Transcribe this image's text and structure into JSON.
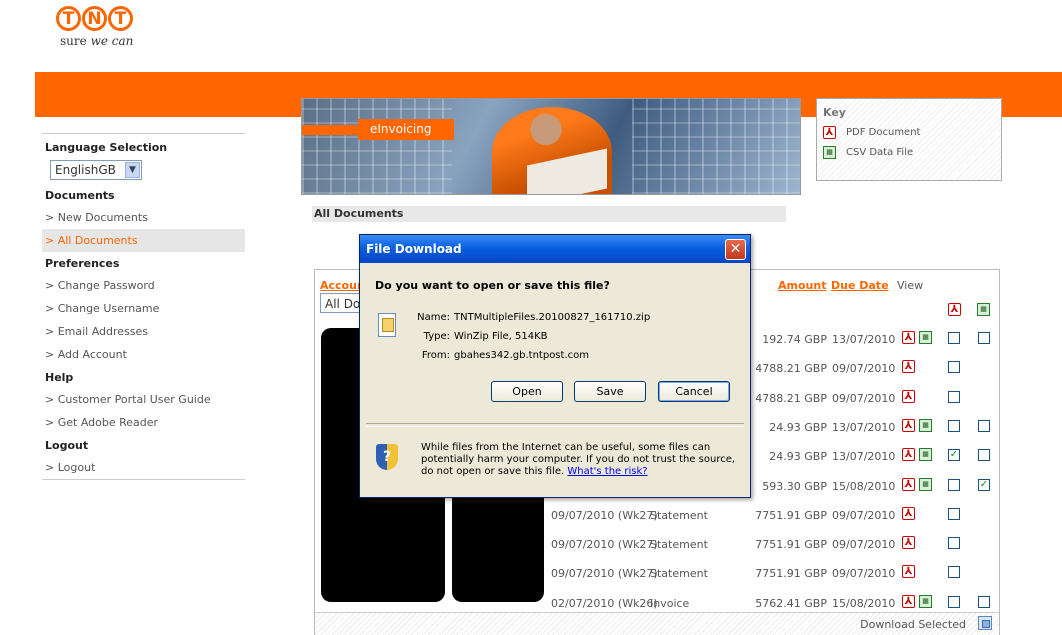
{
  "brand": {
    "letters": [
      "T",
      "N",
      "T"
    ],
    "tagline_prefix": "sure",
    "tagline_italic": "we can"
  },
  "sidebar": {
    "language_heading": "Language Selection",
    "language_value": "EnglishGB",
    "sections": [
      {
        "heading": "Documents",
        "items": [
          {
            "label": "> New Documents",
            "active": false
          },
          {
            "label": "> All Documents",
            "active": true
          }
        ]
      },
      {
        "heading": "Preferences",
        "items": [
          {
            "label": "> Change Password"
          },
          {
            "label": "> Change Username"
          },
          {
            "label": "> Email Addresses"
          },
          {
            "label": "> Add Account"
          }
        ]
      },
      {
        "heading": "Help",
        "items": [
          {
            "label": "> Customer Portal User Guide"
          },
          {
            "label": "> Get Adobe Reader"
          }
        ]
      },
      {
        "heading": "Logout",
        "items": [
          {
            "label": "> Logout"
          }
        ]
      }
    ]
  },
  "banner": {
    "label": "eInvoicing"
  },
  "key": {
    "title": "Key",
    "pdf_label": "PDF Document",
    "csv_label": "CSV Data File"
  },
  "main": {
    "heading": "All Documents"
  },
  "table": {
    "account_header": "Accoun",
    "filter_value": "All Do",
    "amount_header": "Amount",
    "due_header": "Due Date",
    "view_header": "View",
    "rows": [
      {
        "date": "",
        "type": "",
        "amount": "192.74 GBP",
        "due": "13/07/2010",
        "pdf": true,
        "csv": true,
        "c1": false,
        "c2": false,
        "c2_shown": true
      },
      {
        "date": "",
        "type": "",
        "amount": "4788.21 GBP",
        "due": "09/07/2010",
        "pdf": true,
        "csv": false,
        "c1": false,
        "c2": false,
        "c2_shown": false
      },
      {
        "date": "",
        "type": "",
        "amount": "4788.21 GBP",
        "due": "09/07/2010",
        "pdf": true,
        "csv": false,
        "c1": false,
        "c2": false,
        "c2_shown": false
      },
      {
        "date": "",
        "type": "",
        "amount": "24.93 GBP",
        "due": "13/07/2010",
        "pdf": true,
        "csv": true,
        "c1": false,
        "c2": false,
        "c2_shown": true
      },
      {
        "date": "",
        "type": "",
        "amount": "24.93 GBP",
        "due": "13/07/2010",
        "pdf": true,
        "csv": true,
        "c1": true,
        "c2": false,
        "c2_shown": true
      },
      {
        "date": "",
        "type": "",
        "amount": "593.30 GBP",
        "due": "15/08/2010",
        "pdf": true,
        "csv": true,
        "c1": false,
        "c2": true,
        "c2_shown": true
      },
      {
        "date": "09/07/2010 (Wk27)",
        "type": "Statement",
        "amount": "7751.91 GBP",
        "due": "09/07/2010",
        "pdf": true,
        "csv": false,
        "c1": false,
        "c2": false,
        "c2_shown": false
      },
      {
        "date": "09/07/2010 (Wk27)",
        "type": "Statement",
        "amount": "7751.91 GBP",
        "due": "09/07/2010",
        "pdf": true,
        "csv": false,
        "c1": false,
        "c2": false,
        "c2_shown": false
      },
      {
        "date": "09/07/2010 (Wk27)",
        "type": "Statement",
        "amount": "7751.91 GBP",
        "due": "09/07/2010",
        "pdf": true,
        "csv": false,
        "c1": false,
        "c2": false,
        "c2_shown": false
      },
      {
        "date": "02/07/2010 (Wk26)",
        "type": "Invoice",
        "amount": "5762.41 GBP",
        "due": "15/08/2010",
        "pdf": true,
        "csv": true,
        "c1": false,
        "c2": false,
        "c2_shown": true
      }
    ],
    "download_label": "Download Selected"
  },
  "dialog": {
    "title": "File Download",
    "close_glyph": "✕",
    "question": "Do you want to open or save this file?",
    "name_label": "Name:",
    "name_value": "TNTMultipleFiles.20100827_161710.zip",
    "type_label": "Type:",
    "type_value": "WinZip File, 514KB",
    "from_label": "From:",
    "from_value": "gbahes342.gb.tntpost.com",
    "open_label": "Open",
    "save_label": "Save",
    "cancel_label": "Cancel",
    "warning_text": "While files from the Internet can be useful, some files can potentially harm your computer. If you do not trust the source, do not open or save this file.",
    "warning_link": "What's the risk?"
  },
  "colors": {
    "brand_orange": "#ff6600",
    "xp_title": "#0a5fe0",
    "dialog_bg": "#ece9d8"
  },
  "icons": {
    "pdf": "pdf-icon",
    "csv": "csv-icon",
    "shield": "shield-icon",
    "zip": "zip-file-icon",
    "close": "close-icon"
  }
}
